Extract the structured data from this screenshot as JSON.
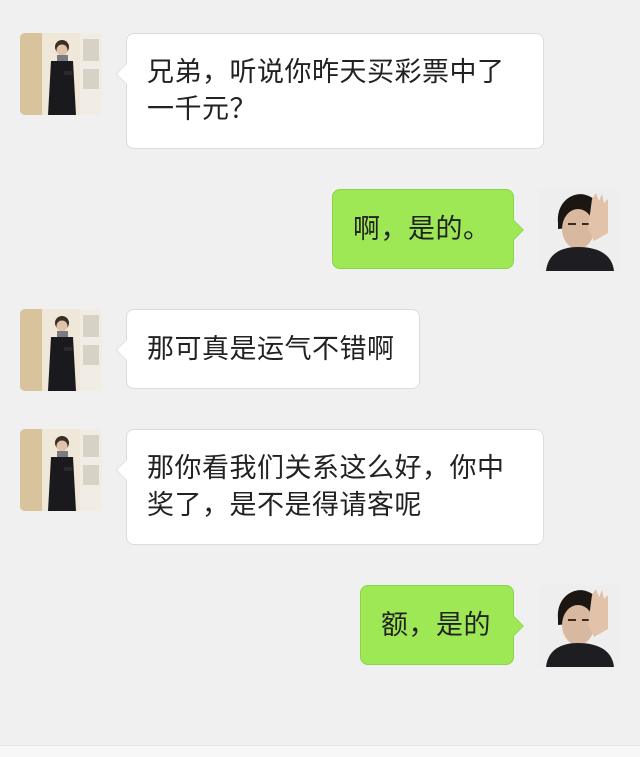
{
  "conversation": {
    "messages": [
      {
        "sender": "friend",
        "text": "兄弟，听说你昨天买彩票中了一千元？"
      },
      {
        "sender": "me",
        "text": "啊，是的。"
      },
      {
        "sender": "friend",
        "text": "那可真是运气不错啊"
      },
      {
        "sender": "friend",
        "text": "那你看我们关系这么好，你中奖了，是不是得请客呢"
      },
      {
        "sender": "me",
        "text": "额，是的"
      }
    ]
  },
  "colors": {
    "background": "#f0f0f0",
    "incoming_bubble": "#ffffff",
    "outgoing_bubble": "#9ee855"
  }
}
